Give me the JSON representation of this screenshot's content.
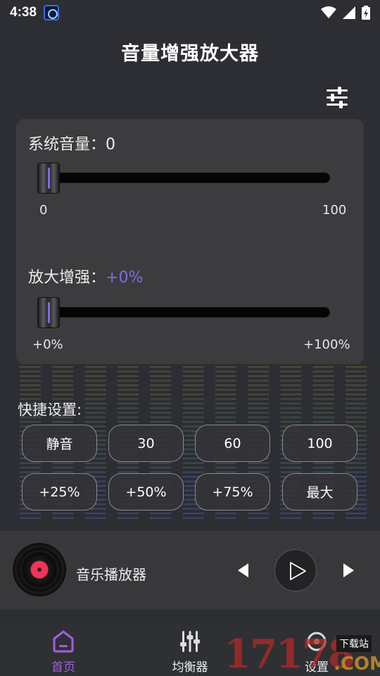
{
  "status_bar": {
    "time": "4:38"
  },
  "header": {
    "title": "音量增强放大器"
  },
  "volume_card": {
    "system_volume": {
      "label": "系统音量：",
      "value": "0",
      "min_label": "0",
      "max_label": "100",
      "level": 0
    },
    "boost": {
      "label": "放大增强：",
      "value": "+0%",
      "min_label": "+0%",
      "max_label": "+100%",
      "level": 0
    }
  },
  "quick_settings": {
    "title": "快捷设置:",
    "buttons": [
      "静音",
      "30",
      "60",
      "100",
      "+25%",
      "+50%",
      "+75%",
      "最大"
    ]
  },
  "player": {
    "title": "音乐播放器"
  },
  "nav": {
    "items": [
      {
        "label": "首页",
        "icon": "home-icon",
        "active": true
      },
      {
        "label": "均衡器",
        "icon": "equalizer-icon",
        "active": false
      },
      {
        "label": "设置",
        "icon": "settings-icon",
        "active": false
      }
    ]
  },
  "watermark": {
    "number": "17178",
    "tag": "下载站",
    "domain": ".COM"
  },
  "colors": {
    "accent": "#7e6be8",
    "background": "#2d2e33",
    "card": "#3c3c3e",
    "record_label": "#f0355a"
  }
}
